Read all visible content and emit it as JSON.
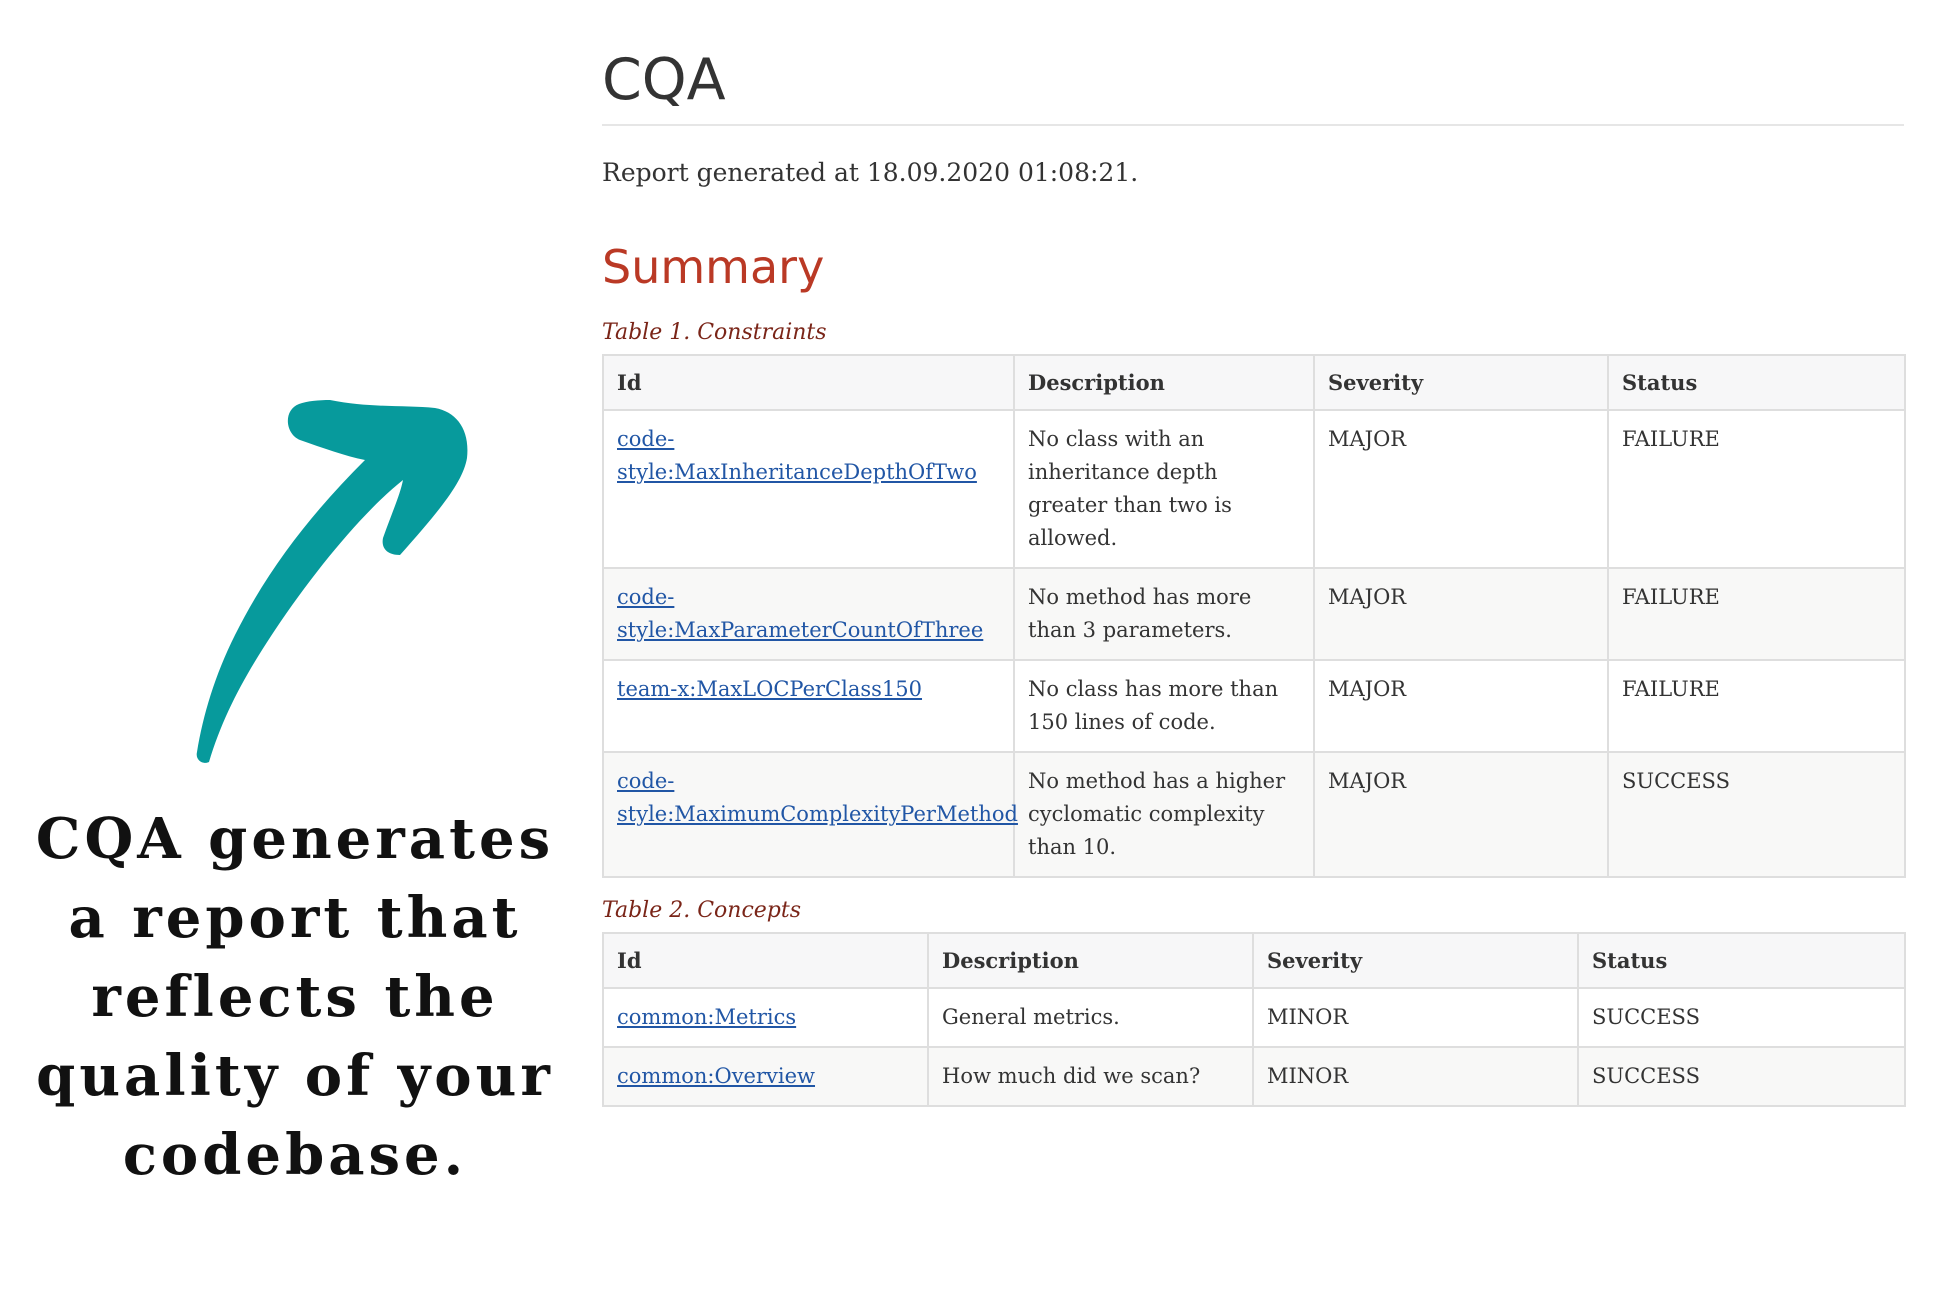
{
  "promo": {
    "caption_lines": [
      "CQA generates",
      "a report that",
      "reflects the",
      "quality of your",
      "codebase."
    ],
    "arrow_icon": "curved-arrow-icon",
    "arrow_color": "#079a9c"
  },
  "report": {
    "title": "CQA",
    "generated_text": "Report generated at 18.09.2020 01:08:21.",
    "summary_heading": "Summary",
    "constraints": {
      "caption": "Table 1. Constraints",
      "headers": {
        "id": "Id",
        "description": "Description",
        "severity": "Severity",
        "status": "Status"
      },
      "rows": [
        {
          "id": "code-style:MaxInheritanceDepthOfTwo",
          "description": "No class with an inheritance depth greater than two is allowed.",
          "severity": "MAJOR",
          "status": "FAILURE"
        },
        {
          "id": "code-style:MaxParameterCountOfThree",
          "description": "No method has more than 3 parameters.",
          "severity": "MAJOR",
          "status": "FAILURE"
        },
        {
          "id": "team-x:MaxLOCPerClass150",
          "description": "No class has more than 150 lines of code.",
          "severity": "MAJOR",
          "status": "FAILURE"
        },
        {
          "id": "code-style:MaximumComplexityPerMethod",
          "description": "No method has a higher cyclomatic complexity than 10.",
          "severity": "MAJOR",
          "status": "SUCCESS"
        }
      ]
    },
    "concepts": {
      "caption": "Table 2. Concepts",
      "headers": {
        "id": "Id",
        "description": "Description",
        "severity": "Severity",
        "status": "Status"
      },
      "rows": [
        {
          "id": "common:Metrics",
          "description": "General metrics.",
          "severity": "MINOR",
          "status": "SUCCESS"
        },
        {
          "id": "common:Overview",
          "description": "How much did we scan?",
          "severity": "MINOR",
          "status": "SUCCESS"
        }
      ]
    }
  },
  "colors": {
    "heading_accent": "#ba3925",
    "caption": "#7a2518",
    "link": "#2156a5",
    "failure": "#d0113a",
    "success": "#23862b"
  }
}
